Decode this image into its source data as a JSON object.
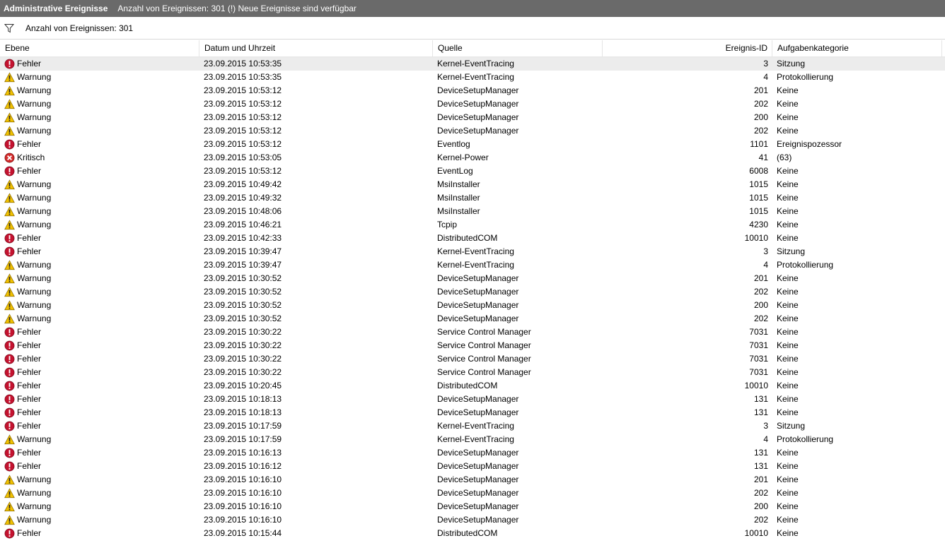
{
  "titlebar": {
    "title": "Administrative Ereignisse",
    "subtitle": "Anzahl von Ereignissen: 301 (!) Neue Ereignisse sind verfügbar"
  },
  "filterbar": {
    "count_label": "Anzahl von Ereignissen: 301"
  },
  "columns": [
    "Ebene",
    "Datum und Uhrzeit",
    "Quelle",
    "Ereignis-ID",
    "Aufgabenkategorie"
  ],
  "colors": {
    "error": "#c4122f",
    "warning": "#f2c200",
    "critical": "#d32c2c",
    "selected": "#ececec"
  },
  "rows": [
    {
      "level": "Fehler",
      "icon": "error-icon",
      "date": "23.09.2015 10:53:35",
      "source": "Kernel-EventTracing",
      "id": "3",
      "task": "Sitzung"
    },
    {
      "level": "Warnung",
      "icon": "warning-icon",
      "date": "23.09.2015 10:53:35",
      "source": "Kernel-EventTracing",
      "id": "4",
      "task": "Protokollierung"
    },
    {
      "level": "Warnung",
      "icon": "warning-icon",
      "date": "23.09.2015 10:53:12",
      "source": "DeviceSetupManager",
      "id": "201",
      "task": "Keine"
    },
    {
      "level": "Warnung",
      "icon": "warning-icon",
      "date": "23.09.2015 10:53:12",
      "source": "DeviceSetupManager",
      "id": "202",
      "task": "Keine"
    },
    {
      "level": "Warnung",
      "icon": "warning-icon",
      "date": "23.09.2015 10:53:12",
      "source": "DeviceSetupManager",
      "id": "200",
      "task": "Keine"
    },
    {
      "level": "Warnung",
      "icon": "warning-icon",
      "date": "23.09.2015 10:53:12",
      "source": "DeviceSetupManager",
      "id": "202",
      "task": "Keine"
    },
    {
      "level": "Fehler",
      "icon": "error-icon",
      "date": "23.09.2015 10:53:12",
      "source": "Eventlog",
      "id": "1101",
      "task": "Ereignispozessor"
    },
    {
      "level": "Kritisch",
      "icon": "critical-icon",
      "date": "23.09.2015 10:53:05",
      "source": "Kernel-Power",
      "id": "41",
      "task": "(63)"
    },
    {
      "level": "Fehler",
      "icon": "error-icon",
      "date": "23.09.2015 10:53:12",
      "source": "EventLog",
      "id": "6008",
      "task": "Keine"
    },
    {
      "level": "Warnung",
      "icon": "warning-icon",
      "date": "23.09.2015 10:49:42",
      "source": "MsiInstaller",
      "id": "1015",
      "task": "Keine"
    },
    {
      "level": "Warnung",
      "icon": "warning-icon",
      "date": "23.09.2015 10:49:32",
      "source": "MsiInstaller",
      "id": "1015",
      "task": "Keine"
    },
    {
      "level": "Warnung",
      "icon": "warning-icon",
      "date": "23.09.2015 10:48:06",
      "source": "MsiInstaller",
      "id": "1015",
      "task": "Keine"
    },
    {
      "level": "Warnung",
      "icon": "warning-icon",
      "date": "23.09.2015 10:46:21",
      "source": "Tcpip",
      "id": "4230",
      "task": "Keine"
    },
    {
      "level": "Fehler",
      "icon": "error-icon",
      "date": "23.09.2015 10:42:33",
      "source": "DistributedCOM",
      "id": "10010",
      "task": "Keine"
    },
    {
      "level": "Fehler",
      "icon": "error-icon",
      "date": "23.09.2015 10:39:47",
      "source": "Kernel-EventTracing",
      "id": "3",
      "task": "Sitzung"
    },
    {
      "level": "Warnung",
      "icon": "warning-icon",
      "date": "23.09.2015 10:39:47",
      "source": "Kernel-EventTracing",
      "id": "4",
      "task": "Protokollierung"
    },
    {
      "level": "Warnung",
      "icon": "warning-icon",
      "date": "23.09.2015 10:30:52",
      "source": "DeviceSetupManager",
      "id": "201",
      "task": "Keine"
    },
    {
      "level": "Warnung",
      "icon": "warning-icon",
      "date": "23.09.2015 10:30:52",
      "source": "DeviceSetupManager",
      "id": "202",
      "task": "Keine"
    },
    {
      "level": "Warnung",
      "icon": "warning-icon",
      "date": "23.09.2015 10:30:52",
      "source": "DeviceSetupManager",
      "id": "200",
      "task": "Keine"
    },
    {
      "level": "Warnung",
      "icon": "warning-icon",
      "date": "23.09.2015 10:30:52",
      "source": "DeviceSetupManager",
      "id": "202",
      "task": "Keine"
    },
    {
      "level": "Fehler",
      "icon": "error-icon",
      "date": "23.09.2015 10:30:22",
      "source": "Service Control Manager",
      "id": "7031",
      "task": "Keine"
    },
    {
      "level": "Fehler",
      "icon": "error-icon",
      "date": "23.09.2015 10:30:22",
      "source": "Service Control Manager",
      "id": "7031",
      "task": "Keine"
    },
    {
      "level": "Fehler",
      "icon": "error-icon",
      "date": "23.09.2015 10:30:22",
      "source": "Service Control Manager",
      "id": "7031",
      "task": "Keine"
    },
    {
      "level": "Fehler",
      "icon": "error-icon",
      "date": "23.09.2015 10:30:22",
      "source": "Service Control Manager",
      "id": "7031",
      "task": "Keine"
    },
    {
      "level": "Fehler",
      "icon": "error-icon",
      "date": "23.09.2015 10:20:45",
      "source": "DistributedCOM",
      "id": "10010",
      "task": "Keine"
    },
    {
      "level": "Fehler",
      "icon": "error-icon",
      "date": "23.09.2015 10:18:13",
      "source": "DeviceSetupManager",
      "id": "131",
      "task": "Keine"
    },
    {
      "level": "Fehler",
      "icon": "error-icon",
      "date": "23.09.2015 10:18:13",
      "source": "DeviceSetupManager",
      "id": "131",
      "task": "Keine"
    },
    {
      "level": "Fehler",
      "icon": "error-icon",
      "date": "23.09.2015 10:17:59",
      "source": "Kernel-EventTracing",
      "id": "3",
      "task": "Sitzung"
    },
    {
      "level": "Warnung",
      "icon": "warning-icon",
      "date": "23.09.2015 10:17:59",
      "source": "Kernel-EventTracing",
      "id": "4",
      "task": "Protokollierung"
    },
    {
      "level": "Fehler",
      "icon": "error-icon",
      "date": "23.09.2015 10:16:13",
      "source": "DeviceSetupManager",
      "id": "131",
      "task": "Keine"
    },
    {
      "level": "Fehler",
      "icon": "error-icon",
      "date": "23.09.2015 10:16:12",
      "source": "DeviceSetupManager",
      "id": "131",
      "task": "Keine"
    },
    {
      "level": "Warnung",
      "icon": "warning-icon",
      "date": "23.09.2015 10:16:10",
      "source": "DeviceSetupManager",
      "id": "201",
      "task": "Keine"
    },
    {
      "level": "Warnung",
      "icon": "warning-icon",
      "date": "23.09.2015 10:16:10",
      "source": "DeviceSetupManager",
      "id": "202",
      "task": "Keine"
    },
    {
      "level": "Warnung",
      "icon": "warning-icon",
      "date": "23.09.2015 10:16:10",
      "source": "DeviceSetupManager",
      "id": "200",
      "task": "Keine"
    },
    {
      "level": "Warnung",
      "icon": "warning-icon",
      "date": "23.09.2015 10:16:10",
      "source": "DeviceSetupManager",
      "id": "202",
      "task": "Keine"
    },
    {
      "level": "Fehler",
      "icon": "error-icon",
      "date": "23.09.2015 10:15:44",
      "source": "DistributedCOM",
      "id": "10010",
      "task": "Keine"
    }
  ]
}
